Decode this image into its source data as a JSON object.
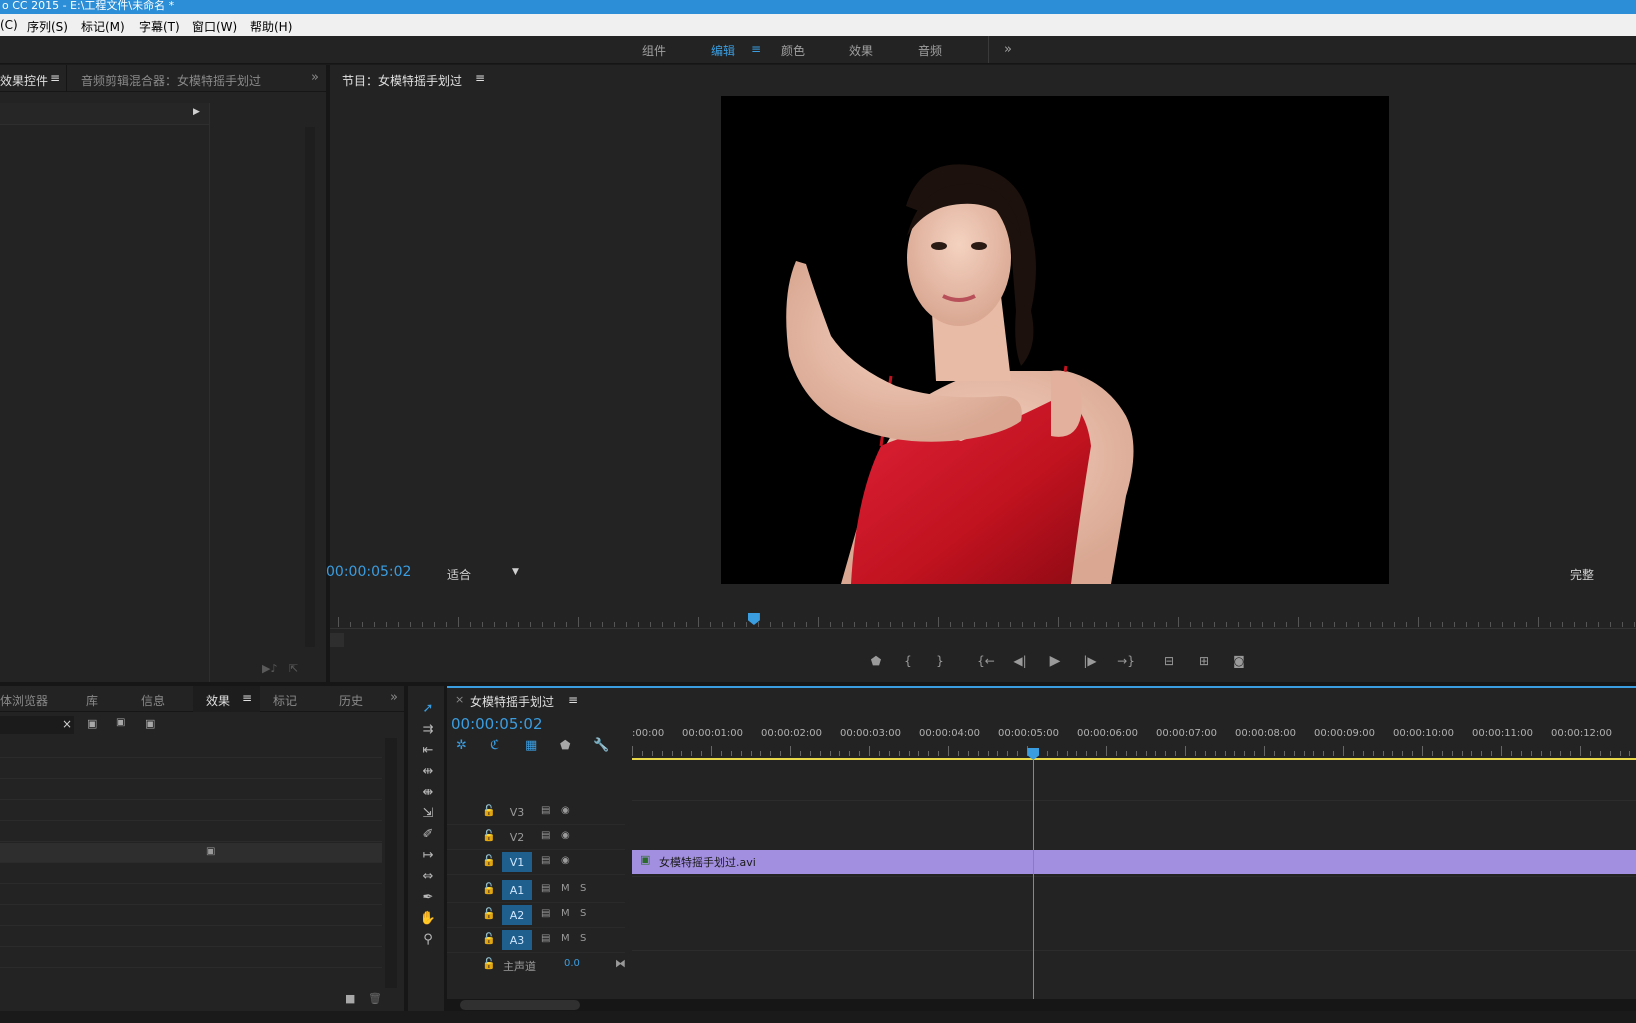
{
  "title_bar": "o CC 2015 - E:\\工程文件\\未命名 *",
  "menu": [
    "(C)",
    "序列(S)",
    "标记(M)",
    "字幕(T)",
    "窗口(W)",
    "帮助(H)"
  ],
  "workspaces": [
    "组件",
    "编辑",
    "颜色",
    "效果",
    "音频"
  ],
  "workspace_active": "编辑",
  "left_panel": {
    "tabs": [
      "效果控件",
      "音频剪辑混合器：女模特摇手划过"
    ]
  },
  "program_monitor": {
    "title": "节目：女模特摇手划过",
    "timecode": "00:00:05:02",
    "zoom": "适合",
    "quality": "完整",
    "playhead_fraction": 0.32
  },
  "bottom_left": {
    "tabs": [
      "体浏览器",
      "库",
      "信息",
      "效果",
      "标记",
      "历史"
    ],
    "active_tab": "效果"
  },
  "timeline": {
    "sequence_name": "女模特摇手划过",
    "timecode": "00:00:05:02",
    "ruler": [
      ":00:00",
      "00:00:01:00",
      "00:00:02:00",
      "00:00:03:00",
      "00:00:04:00",
      "00:00:05:00",
      "00:00:06:00",
      "00:00:07:00",
      "00:00:08:00",
      "00:00:09:00",
      "00:00:10:00",
      "00:00:11:00",
      "00:00:12:00"
    ],
    "video_tracks": [
      "V3",
      "V2",
      "V1"
    ],
    "audio_tracks": [
      "A1",
      "A2",
      "A3"
    ],
    "master_label": "主声道",
    "master_value": "0.0",
    "clip_name": "女模特摇手划过.avi",
    "clip_color": "#a38fe0",
    "m_label": "M",
    "s_label": "S"
  },
  "colors": {
    "accent": "#3a9de0",
    "titlebar": "#2c8ed6",
    "work_area": "#e8d84a"
  }
}
